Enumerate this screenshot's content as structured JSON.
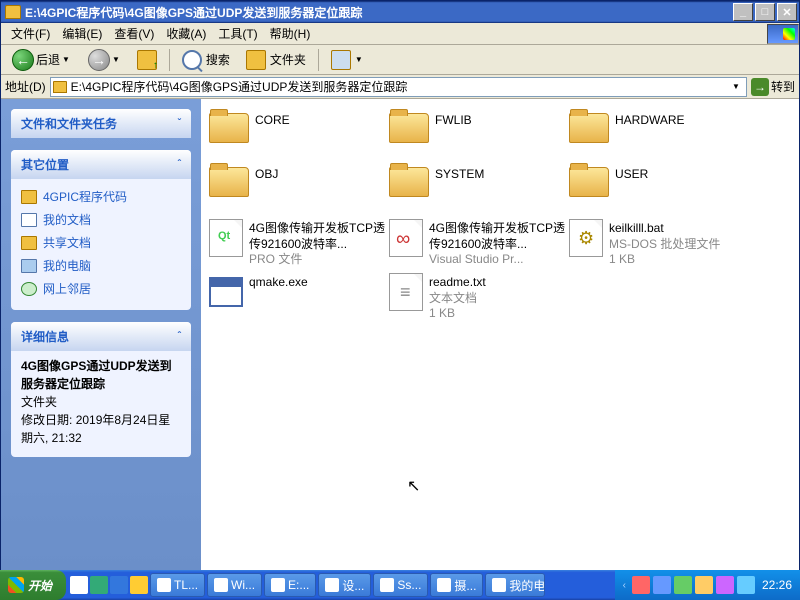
{
  "title": "E:\\4GPIC程序代码\\4G图像GPS通过UDP发送到服务器定位跟踪",
  "menu": [
    "文件(F)",
    "编辑(E)",
    "查看(V)",
    "收藏(A)",
    "工具(T)",
    "帮助(H)"
  ],
  "toolbar": {
    "back": "后退",
    "search": "搜索",
    "folders": "文件夹"
  },
  "addressbar": {
    "label": "地址(D)",
    "path": "E:\\4GPIC程序代码\\4G图像GPS通过UDP发送到服务器定位跟踪",
    "go": "转到"
  },
  "sidebar": {
    "tasks": {
      "title": "文件和文件夹任务"
    },
    "places": {
      "title": "其它位置",
      "items": [
        {
          "label": "4GPIC程序代码",
          "icon": "folder"
        },
        {
          "label": "我的文档",
          "icon": "doc"
        },
        {
          "label": "共享文档",
          "icon": "folder"
        },
        {
          "label": "我的电脑",
          "icon": "comp"
        },
        {
          "label": "网上邻居",
          "icon": "net"
        }
      ]
    },
    "details": {
      "title": "详细信息",
      "name": "4G图像GPS通过UDP发送到服务器定位跟踪",
      "type": "文件夹",
      "modified_label": "修改日期:",
      "modified": "2019年8月24日星期六, 21:32"
    }
  },
  "files": [
    {
      "name": "CORE",
      "type": "folder"
    },
    {
      "name": "FWLIB",
      "type": "folder"
    },
    {
      "name": "HARDWARE",
      "type": "folder"
    },
    {
      "name": "OBJ",
      "type": "folder"
    },
    {
      "name": "SYSTEM",
      "type": "folder"
    },
    {
      "name": "USER",
      "type": "folder"
    },
    {
      "name": "4G图像传输开发板TCP透传921600波特率...",
      "sub": "PRO 文件",
      "type": "file",
      "cls": "green"
    },
    {
      "name": "4G图像传输开发板TCP透传921600波特率...",
      "sub": "Visual Studio Pr...",
      "type": "file",
      "cls": "vs"
    },
    {
      "name": "keilkilll.bat",
      "sub": "MS-DOS 批处理文件",
      "sub2": "1 KB",
      "type": "file",
      "cls": "gear"
    },
    {
      "name": "qmake.exe",
      "type": "exe"
    },
    {
      "name": "readme.txt",
      "sub": "文本文档",
      "sub2": "1 KB",
      "type": "file",
      "cls": "txt"
    }
  ],
  "taskbar": {
    "start": "开始",
    "buttons": [
      "TL...",
      "Wi...",
      "E:...",
      "设...",
      "Ss...",
      "摄...",
      "我的电脑"
    ],
    "clock": "22:26"
  }
}
